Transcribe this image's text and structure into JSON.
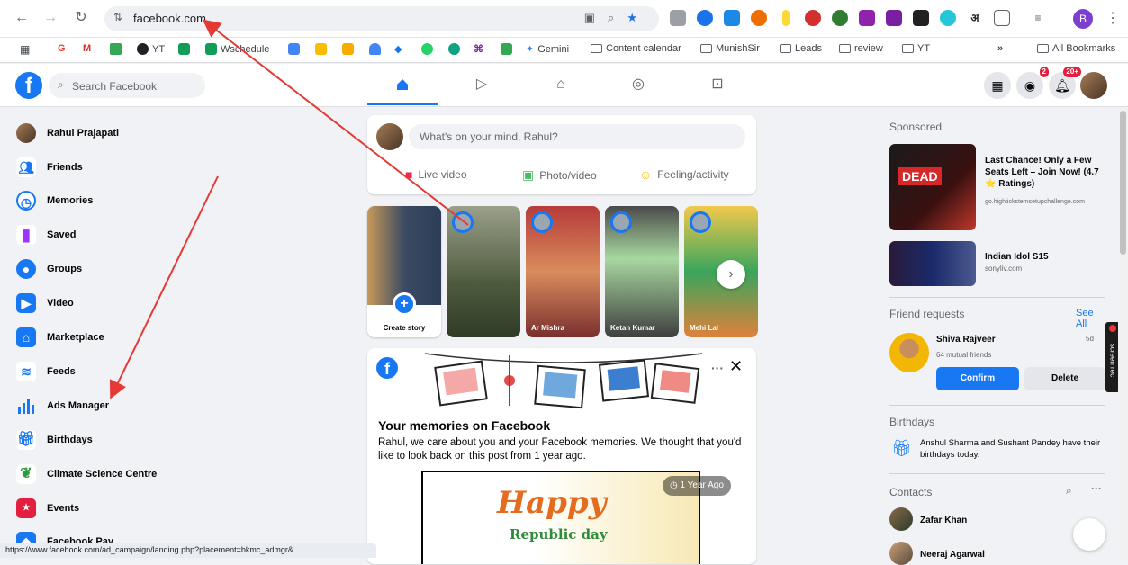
{
  "browser": {
    "url": "facebook.com",
    "status_url": "https://www.facebook.com/ad_campaign/landing.php?placement=bkmc_admgr&...",
    "profile_initial": "B",
    "bookmarks": [
      "YT",
      "Wschedule",
      "Gemini",
      "Content calendar",
      "MunishSir",
      "Leads",
      "review",
      "YT"
    ],
    "all_bookmarks": "All Bookmarks",
    "overflow": "»"
  },
  "topbar": {
    "search_placeholder": "Search Facebook",
    "messenger_badge": "2",
    "notif_badge": "20+"
  },
  "left_nav": {
    "profile_name": "Rahul Prajapati",
    "items": [
      "Friends",
      "Memories",
      "Saved",
      "Groups",
      "Video",
      "Marketplace",
      "Feeds",
      "Ads Manager",
      "Birthdays",
      "Climate Science Centre",
      "Events",
      "Facebook Pay"
    ]
  },
  "composer": {
    "placeholder": "What's on your mind, Rahul?",
    "live": "Live video",
    "photo": "Photo/video",
    "feeling": "Feeling/activity"
  },
  "stories": {
    "create": "Create story",
    "names": [
      "",
      "Ar Mishra",
      "Ketan Kumar",
      "Mehi Lal"
    ]
  },
  "memories": {
    "title": "Your memories on Facebook",
    "body": "Rahul, we care about you and your Facebook memories. We thought that you'd like to look back on this post from 1 year ago.",
    "ago": "1 Year Ago",
    "happy": "Happy",
    "republic": "Republic day"
  },
  "right": {
    "sponsored": "Sponsored",
    "ad1_title": "Last Chance! Only a Few Seats Left – Join Now! (4.7 ⭐ Ratings)",
    "ad1_url": "go.hightickstemsetupchallenge.com",
    "ad1_img_text": "DEAD",
    "ad2_title": "Indian Idol S15",
    "ad2_url": "sonyliv.com",
    "friend_requests": "Friend requests",
    "see_all": "See All",
    "req_name": "Shiva Rajveer",
    "req_time": "5d",
    "req_mutual": "64 mutual friends",
    "confirm": "Confirm",
    "delete": "Delete",
    "birthdays": "Birthdays",
    "bday_text": "Anshul Sharma and Sushant Pandey have their birthdays today.",
    "contacts": "Contacts",
    "contact1": "Zafar Khan",
    "contact2": "Neeraj Agarwal"
  },
  "screenrec": "screen rec",
  "colors": {
    "fb_blue": "#1877f2",
    "annotation_red": "#e53935"
  }
}
